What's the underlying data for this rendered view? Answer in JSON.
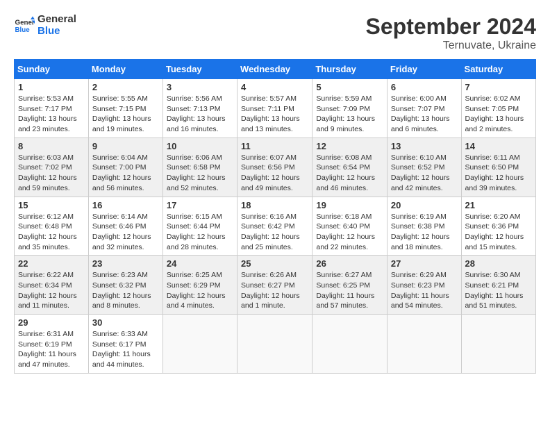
{
  "header": {
    "logo_general": "General",
    "logo_blue": "Blue",
    "month_year": "September 2024",
    "location": "Ternuvate, Ukraine"
  },
  "calendar": {
    "days_of_week": [
      "Sunday",
      "Monday",
      "Tuesday",
      "Wednesday",
      "Thursday",
      "Friday",
      "Saturday"
    ],
    "weeks": [
      [
        {
          "day": "",
          "info": ""
        },
        {
          "day": "",
          "info": ""
        },
        {
          "day": "",
          "info": ""
        },
        {
          "day": "",
          "info": ""
        },
        {
          "day": "5",
          "info": "Sunrise: 5:59 AM\nSunset: 7:09 PM\nDaylight: 13 hours\nand 9 minutes."
        },
        {
          "day": "6",
          "info": "Sunrise: 6:00 AM\nSunset: 7:07 PM\nDaylight: 13 hours\nand 6 minutes."
        },
        {
          "day": "7",
          "info": "Sunrise: 6:02 AM\nSunset: 7:05 PM\nDaylight: 13 hours\nand 2 minutes."
        }
      ],
      [
        {
          "day": "1",
          "info": "Sunrise: 5:53 AM\nSunset: 7:17 PM\nDaylight: 13 hours\nand 23 minutes."
        },
        {
          "day": "2",
          "info": "Sunrise: 5:55 AM\nSunset: 7:15 PM\nDaylight: 13 hours\nand 19 minutes."
        },
        {
          "day": "3",
          "info": "Sunrise: 5:56 AM\nSunset: 7:13 PM\nDaylight: 13 hours\nand 16 minutes."
        },
        {
          "day": "4",
          "info": "Sunrise: 5:57 AM\nSunset: 7:11 PM\nDaylight: 13 hours\nand 13 minutes."
        },
        {
          "day": "5",
          "info": "Sunrise: 5:59 AM\nSunset: 7:09 PM\nDaylight: 13 hours\nand 9 minutes."
        },
        {
          "day": "6",
          "info": "Sunrise: 6:00 AM\nSunset: 7:07 PM\nDaylight: 13 hours\nand 6 minutes."
        },
        {
          "day": "7",
          "info": "Sunrise: 6:02 AM\nSunset: 7:05 PM\nDaylight: 13 hours\nand 2 minutes."
        }
      ],
      [
        {
          "day": "8",
          "info": "Sunrise: 6:03 AM\nSunset: 7:02 PM\nDaylight: 12 hours\nand 59 minutes."
        },
        {
          "day": "9",
          "info": "Sunrise: 6:04 AM\nSunset: 7:00 PM\nDaylight: 12 hours\nand 56 minutes."
        },
        {
          "day": "10",
          "info": "Sunrise: 6:06 AM\nSunset: 6:58 PM\nDaylight: 12 hours\nand 52 minutes."
        },
        {
          "day": "11",
          "info": "Sunrise: 6:07 AM\nSunset: 6:56 PM\nDaylight: 12 hours\nand 49 minutes."
        },
        {
          "day": "12",
          "info": "Sunrise: 6:08 AM\nSunset: 6:54 PM\nDaylight: 12 hours\nand 46 minutes."
        },
        {
          "day": "13",
          "info": "Sunrise: 6:10 AM\nSunset: 6:52 PM\nDaylight: 12 hours\nand 42 minutes."
        },
        {
          "day": "14",
          "info": "Sunrise: 6:11 AM\nSunset: 6:50 PM\nDaylight: 12 hours\nand 39 minutes."
        }
      ],
      [
        {
          "day": "15",
          "info": "Sunrise: 6:12 AM\nSunset: 6:48 PM\nDaylight: 12 hours\nand 35 minutes."
        },
        {
          "day": "16",
          "info": "Sunrise: 6:14 AM\nSunset: 6:46 PM\nDaylight: 12 hours\nand 32 minutes."
        },
        {
          "day": "17",
          "info": "Sunrise: 6:15 AM\nSunset: 6:44 PM\nDaylight: 12 hours\nand 28 minutes."
        },
        {
          "day": "18",
          "info": "Sunrise: 6:16 AM\nSunset: 6:42 PM\nDaylight: 12 hours\nand 25 minutes."
        },
        {
          "day": "19",
          "info": "Sunrise: 6:18 AM\nSunset: 6:40 PM\nDaylight: 12 hours\nand 22 minutes."
        },
        {
          "day": "20",
          "info": "Sunrise: 6:19 AM\nSunset: 6:38 PM\nDaylight: 12 hours\nand 18 minutes."
        },
        {
          "day": "21",
          "info": "Sunrise: 6:20 AM\nSunset: 6:36 PM\nDaylight: 12 hours\nand 15 minutes."
        }
      ],
      [
        {
          "day": "22",
          "info": "Sunrise: 6:22 AM\nSunset: 6:34 PM\nDaylight: 12 hours\nand 11 minutes."
        },
        {
          "day": "23",
          "info": "Sunrise: 6:23 AM\nSunset: 6:32 PM\nDaylight: 12 hours\nand 8 minutes."
        },
        {
          "day": "24",
          "info": "Sunrise: 6:25 AM\nSunset: 6:29 PM\nDaylight: 12 hours\nand 4 minutes."
        },
        {
          "day": "25",
          "info": "Sunrise: 6:26 AM\nSunset: 6:27 PM\nDaylight: 12 hours\nand 1 minute."
        },
        {
          "day": "26",
          "info": "Sunrise: 6:27 AM\nSunset: 6:25 PM\nDaylight: 11 hours\nand 57 minutes."
        },
        {
          "day": "27",
          "info": "Sunrise: 6:29 AM\nSunset: 6:23 PM\nDaylight: 11 hours\nand 54 minutes."
        },
        {
          "day": "28",
          "info": "Sunrise: 6:30 AM\nSunset: 6:21 PM\nDaylight: 11 hours\nand 51 minutes."
        }
      ],
      [
        {
          "day": "29",
          "info": "Sunrise: 6:31 AM\nSunset: 6:19 PM\nDaylight: 11 hours\nand 47 minutes."
        },
        {
          "day": "30",
          "info": "Sunrise: 6:33 AM\nSunset: 6:17 PM\nDaylight: 11 hours\nand 44 minutes."
        },
        {
          "day": "",
          "info": ""
        },
        {
          "day": "",
          "info": ""
        },
        {
          "day": "",
          "info": ""
        },
        {
          "day": "",
          "info": ""
        },
        {
          "day": "",
          "info": ""
        }
      ]
    ]
  }
}
